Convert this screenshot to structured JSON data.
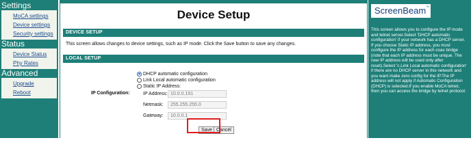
{
  "sidebar": {
    "sections": [
      {
        "title": "Settings",
        "items": [
          "MoCA settings",
          "Device settings",
          "Security settings"
        ]
      },
      {
        "title": "Status",
        "items": [
          "Device Status",
          "Phy Rates"
        ]
      },
      {
        "title": "Advanced",
        "items": [
          "Upgrade",
          "Reboot"
        ]
      }
    ]
  },
  "main": {
    "title": "Device Setup",
    "device_section": {
      "header": "DEVICE SETUP",
      "description": "This screen allows changes to device settings, such as IP mode. Click the Save button to save any changes."
    },
    "local_section": {
      "header": "LOCAL SETUP",
      "ip_config_label": "IP Configuration:",
      "options": [
        {
          "label": "DHCP automatic configuration",
          "selected": true
        },
        {
          "label": "Link Local automatic configuration",
          "selected": false
        },
        {
          "label": "Static IP Address:",
          "selected": false
        }
      ],
      "fields": {
        "ip_label": "IP Address:",
        "ip_value": "10.0.0.191",
        "netmask_label": "Netmask:",
        "netmask_value": "255.255.255.0",
        "gateway_label": "Gateway:",
        "gateway_value": "10.0.0.1"
      }
    },
    "buttons": {
      "save": "Save",
      "cancel": "Cancel"
    }
  },
  "help": {
    "logo": "ScreenBeam",
    "logo_mark": "™",
    "text": "This screen allows you to configure the IP mode and telnet server.Select 'DHCP automatic configuration' if your network has a DHCP server. If you choose Static IP address, you must configure the IP address for each coax bridge (note that each IP address must be unique. The new IP address will be used only after reset).Select 'c.Link Local automatic configuration' if there are no DHCP server in this network and you want make zero config for the IP.The IP address will not apply if Automatic Configuration (DHCP) is selected.If you enable MoCA telnet, then you can access the bridge by telnet protocol."
  },
  "colors": {
    "teal": "#1e7f78",
    "nav_link": "#1a4a8c",
    "highlight": "#e01b1b"
  }
}
